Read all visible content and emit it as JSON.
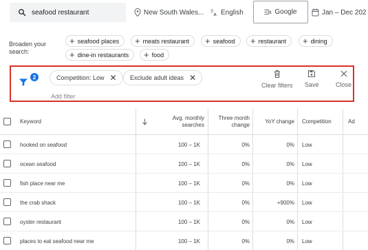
{
  "top": {
    "search_query": "seafood restaurant",
    "location": "New South Wales...",
    "language": "English",
    "engine": "Google",
    "date_range": "Jan – Dec 202"
  },
  "broaden": {
    "label": "Broaden your search:",
    "chips": [
      "seafood places",
      "meats restaurant",
      "seafood",
      "restaurant",
      "dining",
      "dine-in restaurants",
      "food"
    ]
  },
  "filter_panel": {
    "badge_count": "2",
    "filters": [
      "Competition: Low",
      "Exclude adult ideas"
    ],
    "add_filter": "Add filter",
    "clear_filters": "Clear filters",
    "save": "Save",
    "close": "Close",
    "highlight_color": "#d93025"
  },
  "table": {
    "headers": {
      "keyword": "Keyword",
      "avg_monthly": "Avg. monthly searches",
      "three_month": "Three month change",
      "yoy": "YoY change",
      "competition": "Competition",
      "ad": "Ad"
    },
    "rows": [
      {
        "keyword": "hooked on seafood",
        "avg": "100 – 1K",
        "three": "0%",
        "yoy": "0%",
        "competition": "Low"
      },
      {
        "keyword": "ocean seafood",
        "avg": "100 – 1K",
        "three": "0%",
        "yoy": "0%",
        "competition": "Low"
      },
      {
        "keyword": "fish place near me",
        "avg": "100 – 1K",
        "three": "0%",
        "yoy": "0%",
        "competition": "Low"
      },
      {
        "keyword": "the crab shack",
        "avg": "100 – 1K",
        "three": "0%",
        "yoy": "+900%",
        "competition": "Low"
      },
      {
        "keyword": "oyster restaurant",
        "avg": "100 – 1K",
        "three": "0%",
        "yoy": "0%",
        "competition": "Low"
      },
      {
        "keyword": "places to eat seafood near me",
        "avg": "100 – 1K",
        "three": "0%",
        "yoy": "0%",
        "competition": "Low"
      }
    ]
  }
}
